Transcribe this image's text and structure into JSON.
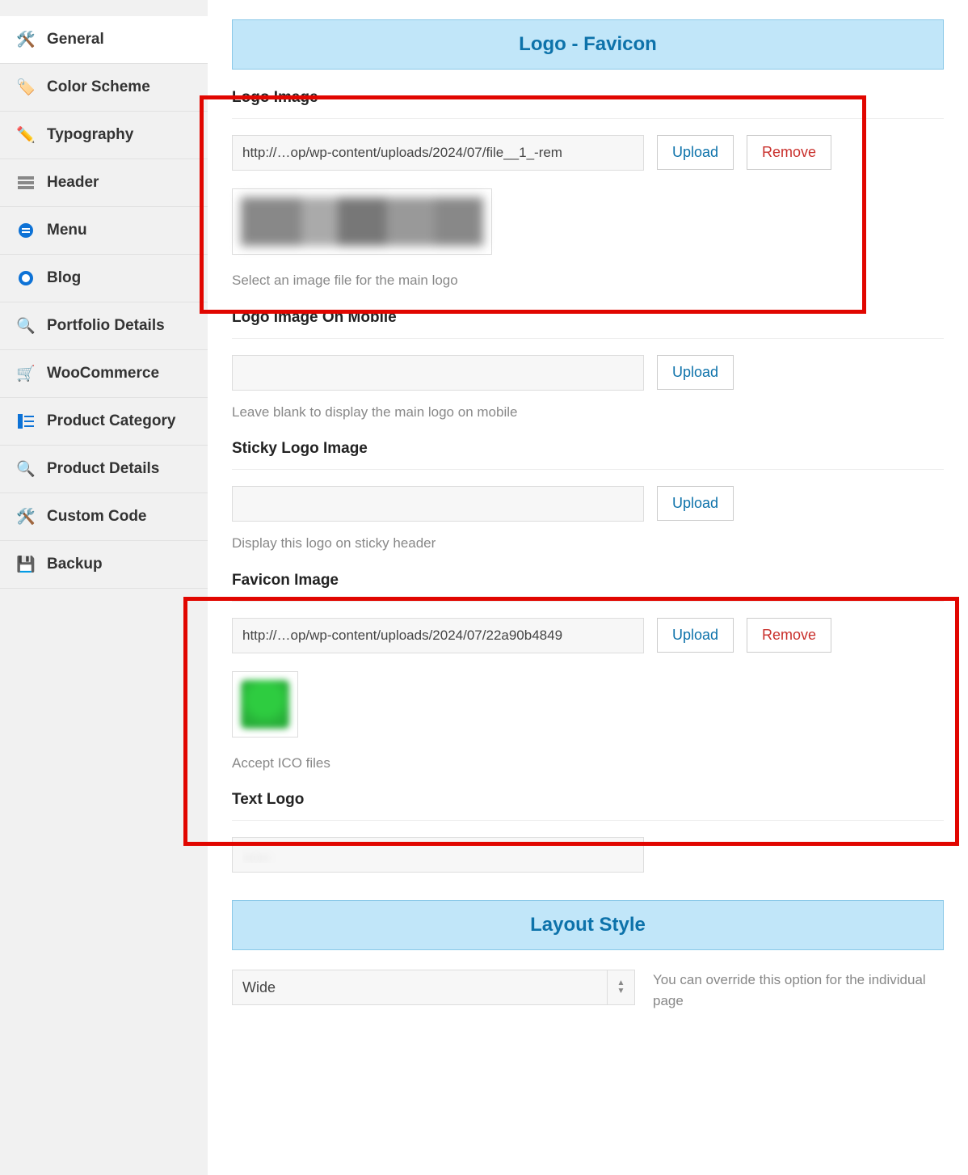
{
  "sidebar": {
    "items": [
      {
        "label": "General",
        "icon": "wrench-icon"
      },
      {
        "label": "Color Scheme",
        "icon": "paint-icon"
      },
      {
        "label": "Typography",
        "icon": "pencil-icon"
      },
      {
        "label": "Header",
        "icon": "layout-icon"
      },
      {
        "label": "Menu",
        "icon": "menu-circle-icon"
      },
      {
        "label": "Blog",
        "icon": "globe-icon"
      },
      {
        "label": "Portfolio Details",
        "icon": "search-icon"
      },
      {
        "label": "WooCommerce",
        "icon": "cart-icon"
      },
      {
        "label": "Product Category",
        "icon": "list-icon"
      },
      {
        "label": "Product Details",
        "icon": "search-icon"
      },
      {
        "label": "Custom Code",
        "icon": "tools-icon"
      },
      {
        "label": "Backup",
        "icon": "save-icon"
      }
    ]
  },
  "sections": {
    "logo_favicon_title": "Logo - Favicon",
    "layout_style_title": "Layout Style"
  },
  "fields": {
    "logo_image": {
      "label": "Logo Image",
      "value": "http://…op/wp-content/uploads/2024/07/file__1_-rem",
      "help": "Select an image file for the main logo",
      "upload": "Upload",
      "remove": "Remove"
    },
    "logo_mobile": {
      "label": "Logo Image On Mobile",
      "value": "",
      "help": "Leave blank to display the main logo on mobile",
      "upload": "Upload"
    },
    "sticky_logo": {
      "label": "Sticky Logo Image",
      "value": "",
      "help": "Display this logo on sticky header",
      "upload": "Upload"
    },
    "favicon": {
      "label": "Favicon Image",
      "value": "http://…op/wp-content/uploads/2024/07/22a90b4849",
      "help": "Accept ICO files",
      "upload": "Upload",
      "remove": "Remove"
    },
    "text_logo": {
      "label": "Text Logo",
      "value": "……"
    },
    "layout": {
      "value": "Wide",
      "help": "You can override this option for the individual page"
    }
  }
}
